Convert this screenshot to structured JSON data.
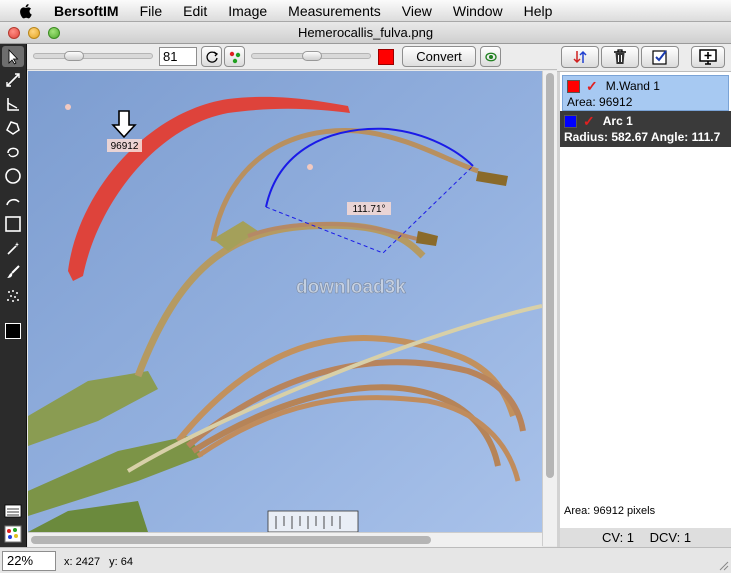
{
  "menubar": {
    "apple_icon": "apple-icon",
    "items": [
      "BersoftIM",
      "File",
      "Edit",
      "Image",
      "Measurements",
      "View",
      "Window",
      "Help"
    ]
  },
  "window": {
    "title": "Hemerocallis_fulva.png"
  },
  "controls": {
    "value": "81",
    "convert_label": "Convert",
    "swatch_color": "#ff0000"
  },
  "annotations": {
    "area_label": "96912",
    "angle_label": "111.71°",
    "watermark": "download3k"
  },
  "measurements": {
    "items": [
      {
        "name": "M.Wand 1",
        "color": "#ff0000",
        "detail": "Area: 96912"
      },
      {
        "name": "Arc 1",
        "color": "#0000ff",
        "detail": "Radius: 582.67 Angle: 111.7"
      }
    ],
    "summary": "Area: 96912 pixels",
    "cv": "CV: 1",
    "dcv": "DCV: 1"
  },
  "status": {
    "zoom": "22%",
    "x": "x: 2427",
    "y": "y: 64"
  }
}
